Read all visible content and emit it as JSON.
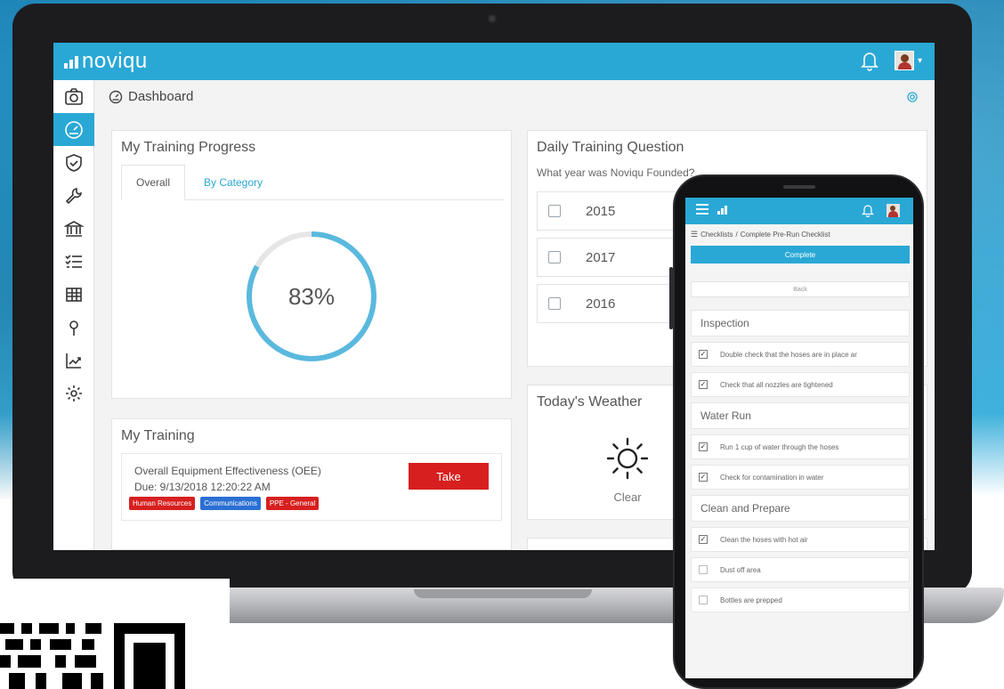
{
  "brand": {
    "name": "noviqu",
    "accent": "#2aa8d5",
    "danger": "#d71f1f"
  },
  "header": {
    "notification_icon": "bell-icon",
    "avatar": "user-avatar"
  },
  "sidebar": {
    "items": [
      {
        "name": "camera",
        "icon": "camera-icon",
        "active": false
      },
      {
        "name": "dashboard",
        "icon": "dashboard-gauge-icon",
        "active": true
      },
      {
        "name": "safety",
        "icon": "shield-check-icon",
        "active": false
      },
      {
        "name": "maintenance",
        "icon": "wrench-icon",
        "active": false
      },
      {
        "name": "institution",
        "icon": "bank-icon",
        "active": false
      },
      {
        "name": "checklists",
        "icon": "checklist-icon",
        "active": false
      },
      {
        "name": "table",
        "icon": "grid-table-icon",
        "active": false
      },
      {
        "name": "location",
        "icon": "map-pin-icon",
        "active": false
      },
      {
        "name": "analytics",
        "icon": "trend-chart-icon",
        "active": false
      },
      {
        "name": "settings",
        "icon": "gear-icon",
        "active": false
      }
    ]
  },
  "breadcrumb": {
    "label": "Dashboard"
  },
  "progress": {
    "title": "My Training Progress",
    "tabs": [
      "Overall",
      "By Category"
    ],
    "percent_label": "83%",
    "percent_value": 0.83
  },
  "training": {
    "title": "My Training",
    "item": {
      "name": "Overall Equipment Effectiveness (OEE)",
      "due": "Due: 9/13/2018 12:20:22 AM",
      "action": "Take",
      "badges": [
        {
          "label": "Human Resources",
          "color": "#d71f1f"
        },
        {
          "label": "Communications",
          "color": "#2b6fd4"
        },
        {
          "label": "PPE - General",
          "color": "#d71f1f"
        }
      ]
    }
  },
  "question": {
    "title": "Daily Training Question",
    "text": "What year was Noviqu Founded?",
    "options": [
      "2015",
      "2017",
      "2016"
    ]
  },
  "weather": {
    "title": "Today's Weather",
    "icon": "sun-icon",
    "description": "Clear"
  },
  "phone": {
    "breadcrumb": {
      "root": "Checklists",
      "separator": "/",
      "current": "Complete Pre-Run Checklist"
    },
    "complete_button": "Complete",
    "back_button": "Back",
    "sections": [
      {
        "title": "Inspection",
        "items": [
          {
            "label": "Double check that the hoses are in place ar",
            "checked": true
          },
          {
            "label": "Check that all nozzles are tightened",
            "checked": true
          }
        ]
      },
      {
        "title": "Water Run",
        "items": [
          {
            "label": "Run 1 cup of water through the hoses",
            "checked": true
          },
          {
            "label": "Check for contamination in water",
            "checked": true
          }
        ]
      },
      {
        "title": "Clean and Prepare",
        "items": [
          {
            "label": "Clean the hoses with hot air",
            "checked": true
          },
          {
            "label": "Dust off area",
            "checked": false
          },
          {
            "label": "Bottles are prepped",
            "checked": false
          }
        ]
      }
    ]
  }
}
